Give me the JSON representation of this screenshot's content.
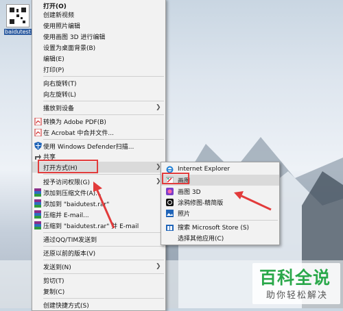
{
  "desktop": {
    "icon_label": "baidutest"
  },
  "context_menu": {
    "items": [
      {
        "label": "打开(O)",
        "bold": true
      },
      {
        "label": "创建新视频"
      },
      {
        "label": "使用照片编辑"
      },
      {
        "label": "使用画图 3D 进行编辑"
      },
      {
        "label": "设置为桌面背景(B)"
      },
      {
        "label": "编辑(E)"
      },
      {
        "label": "打印(P)"
      },
      {
        "label": "向右旋转(T)"
      },
      {
        "label": "向左旋转(L)"
      },
      {
        "label": "播放到设备",
        "submenu": true
      },
      {
        "label": "转换为 Adobe PDF(B)",
        "icon": "adobe-pdf-icon"
      },
      {
        "label": "在 Acrobat 中合并文件...",
        "icon": "adobe-pdf-icon"
      },
      {
        "label": "使用 Windows Defender扫描...",
        "icon": "defender-shield-icon"
      },
      {
        "label": "共享",
        "icon": "share-icon"
      },
      {
        "label": "打开方式(H)",
        "submenu": true,
        "highlighted": true
      },
      {
        "label": "授予访问权限(G)",
        "submenu": true
      },
      {
        "label": "添加到压缩文件(A)...",
        "icon": "winrar-icon"
      },
      {
        "label": "添加到 \"baidutest.rar\"",
        "icon": "winrar-icon"
      },
      {
        "label": "压缩并 E-mail...",
        "icon": "winrar-icon"
      },
      {
        "label": "压缩到 \"baidutest.rar\" 并 E-mail",
        "icon": "winrar-icon"
      },
      {
        "label": "通过QQ/TIM发送到"
      },
      {
        "label": "还原以前的版本(V)"
      },
      {
        "label": "发送到(N)",
        "submenu": true
      },
      {
        "label": "剪切(T)"
      },
      {
        "label": "复制(C)"
      },
      {
        "label": "创建快捷方式(S)"
      }
    ]
  },
  "open_with_menu": {
    "items": [
      {
        "label": "Internet Explorer",
        "icon": "internet-explorer-icon"
      },
      {
        "label": "画图",
        "icon": "paint-icon",
        "highlighted": true
      },
      {
        "label": "画图 3D",
        "icon": "paint-3d-icon"
      },
      {
        "label": "涂鸦修图-精简版",
        "icon": "doodle-app-icon"
      },
      {
        "label": "照片",
        "icon": "photos-icon"
      },
      {
        "label": "搜索 Microsoft Store (S)",
        "icon": "store-icon"
      },
      {
        "label": "选择其他应用(C)"
      }
    ]
  },
  "watermark": {
    "title": "百科全说",
    "subtitle": "助你轻松解决"
  },
  "colors": {
    "highlight_box": "#e23b3b",
    "menu_bg": "#f2f2f2",
    "watermark_green": "#2aa84a"
  }
}
